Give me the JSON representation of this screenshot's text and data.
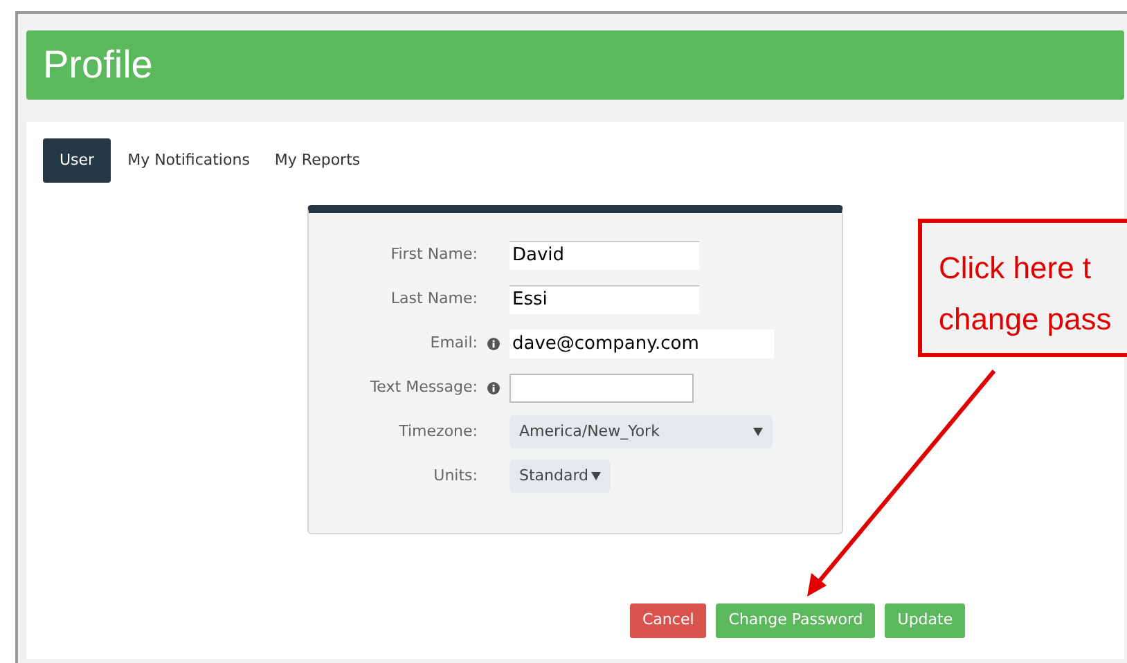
{
  "header": {
    "title": "Profile"
  },
  "tabs": [
    {
      "label": "User",
      "selected": true
    },
    {
      "label": "My Notifications",
      "selected": false
    },
    {
      "label": "My Reports",
      "selected": false
    }
  ],
  "form": {
    "fields": [
      {
        "kind": "text",
        "label": "First Name:",
        "value": "David",
        "info": false
      },
      {
        "kind": "text",
        "label": "Last Name:",
        "value": "Essi",
        "info": false
      },
      {
        "kind": "text",
        "label": "Email:",
        "value": "dave@company.com",
        "info": true
      },
      {
        "kind": "text",
        "label": "Text Message:",
        "info": true
      },
      {
        "kind": "select",
        "label": "Timezone:",
        "value": "America/New_York",
        "info": false
      },
      {
        "kind": "select_small",
        "label": "Units:",
        "value": "Standard",
        "info": false
      }
    ]
  },
  "buttons": [
    {
      "label": "Cancel",
      "kind": "danger"
    },
    {
      "label": "Change Password",
      "kind": "success"
    },
    {
      "label": "Update",
      "kind": "success"
    }
  ],
  "callout": {
    "lines": [
      "Click here t",
      "change pass"
    ]
  }
}
